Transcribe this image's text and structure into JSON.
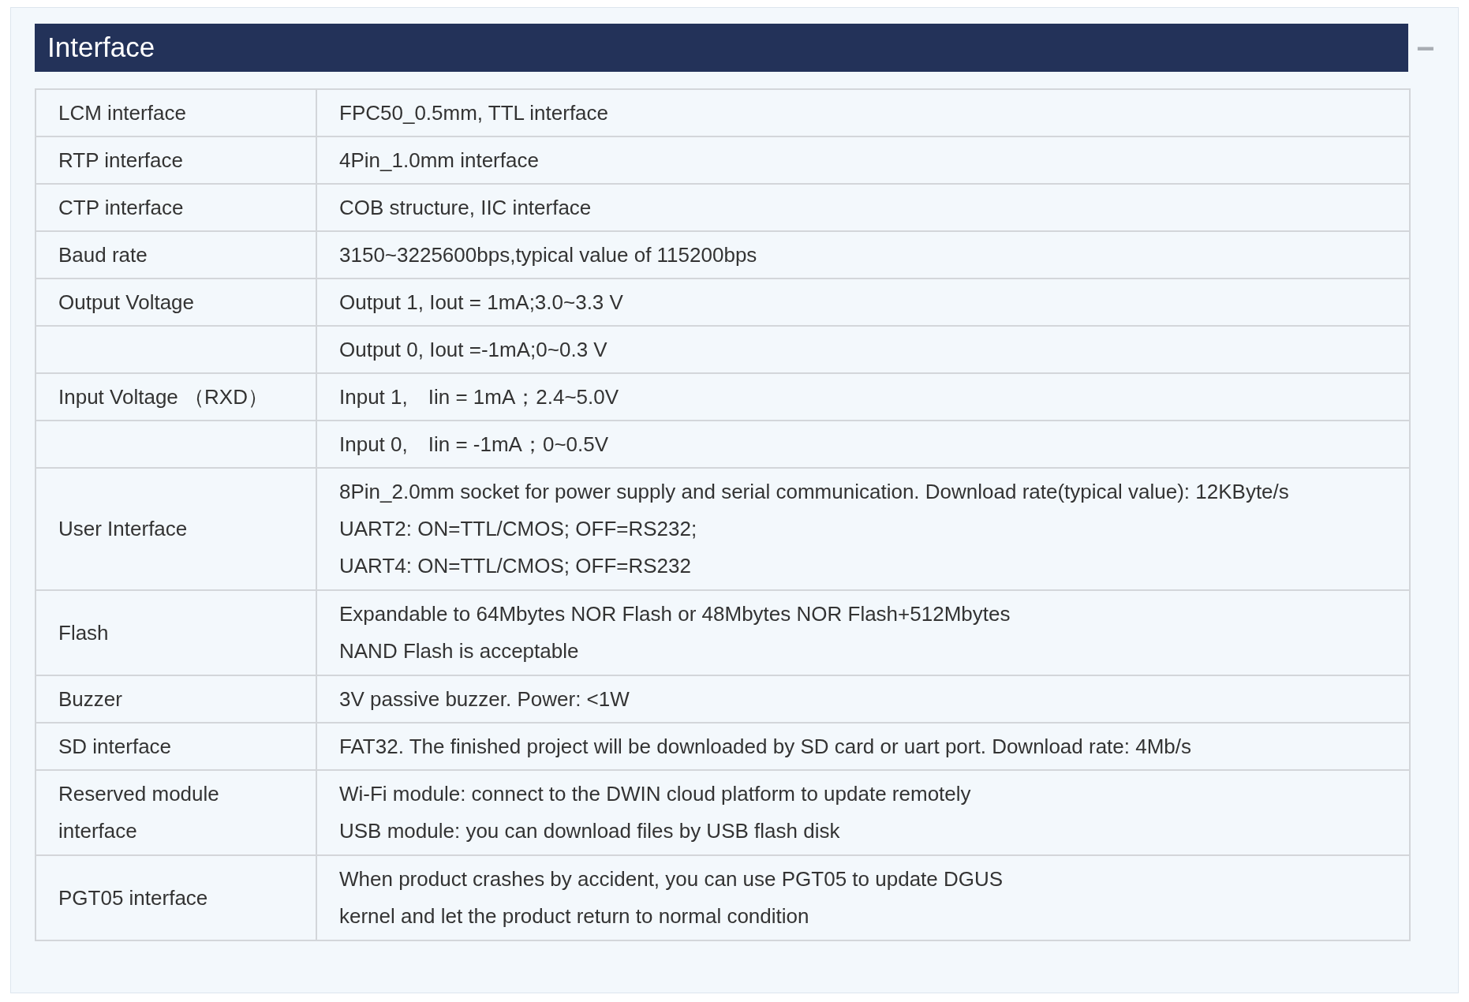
{
  "panel": {
    "title": "Interface",
    "collapse_symbol": "−"
  },
  "table": {
    "rows": [
      {
        "label": "LCM interface",
        "value": [
          "FPC50_0.5mm, TTL interface"
        ]
      },
      {
        "label": "RTP interface",
        "value": [
          "4Pin_1.0mm interface"
        ]
      },
      {
        "label": "CTP interface",
        "value": [
          "COB structure, IIC interface"
        ]
      },
      {
        "label": "Baud rate",
        "value": [
          "3150~3225600bps,typical value of 115200bps"
        ]
      },
      {
        "label": "Output Voltage",
        "value": [
          "Output 1, Iout = 1mA;3.0~3.3 V"
        ]
      },
      {
        "label": "",
        "value": [
          "Output 0, Iout =-1mA;0~0.3 V"
        ]
      },
      {
        "label": "Input Voltage （RXD）",
        "value": [
          "Input 1,　Iin = 1mA；2.4~5.0V"
        ]
      },
      {
        "label": "",
        "value": [
          "Input 0,　Iin = -1mA；0~0.5V"
        ]
      },
      {
        "label": "User Interface",
        "value": [
          "8Pin_2.0mm socket for power supply and serial communication. Download rate(typical value): 12KByte/s",
          "UART2: ON=TTL/CMOS; OFF=RS232;",
          "UART4: ON=TTL/CMOS; OFF=RS232"
        ]
      },
      {
        "label": "Flash",
        "value": [
          "Expandable to 64Mbytes NOR Flash or 48Mbytes NOR Flash+512Mbytes",
          "NAND Flash is acceptable"
        ]
      },
      {
        "label": "Buzzer",
        "value": [
          "3V passive buzzer. Power: <1W"
        ]
      },
      {
        "label": "SD interface",
        "value": [
          "FAT32. The finished project will be downloaded by SD card or uart port. Download rate: 4Mb/s"
        ]
      },
      {
        "label": "Reserved module interface",
        "value": [
          "Wi-Fi module: connect to the DWIN cloud platform to update remotely",
          "USB module: you can download files by USB flash disk"
        ]
      },
      {
        "label": "PGT05 interface",
        "value": [
          "When product crashes by accident, you can use PGT05 to update DGUS",
          "kernel and let the product return to normal condition"
        ]
      }
    ]
  }
}
